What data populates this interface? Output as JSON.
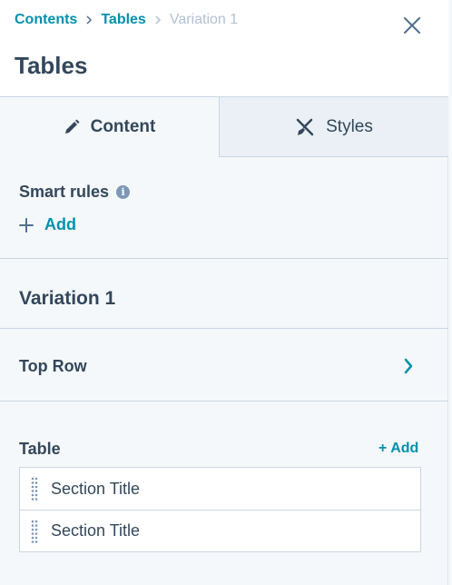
{
  "breadcrumb": {
    "items": [
      {
        "label": "Contents"
      },
      {
        "label": "Tables"
      },
      {
        "label": "Variation 1"
      }
    ]
  },
  "header": {
    "title": "Tables",
    "close_icon": "close-icon"
  },
  "tabs": [
    {
      "label": "Content",
      "icon": "pencil-icon",
      "active": true
    },
    {
      "label": "Styles",
      "icon": "brush-icon",
      "active": false
    }
  ],
  "smart_rules": {
    "label": "Smart rules",
    "add_label": "Add"
  },
  "variation": {
    "title": "Variation 1"
  },
  "top_row": {
    "label": "Top Row"
  },
  "table": {
    "label": "Table",
    "add_label": "+ Add",
    "items": [
      {
        "label": "Section Title"
      },
      {
        "label": "Section Title"
      }
    ]
  },
  "colors": {
    "accent": "#0091ae",
    "text": "#33475b",
    "muted": "#b0c1d4",
    "border": "#cbd6e2",
    "background": "#f5f8fa"
  }
}
